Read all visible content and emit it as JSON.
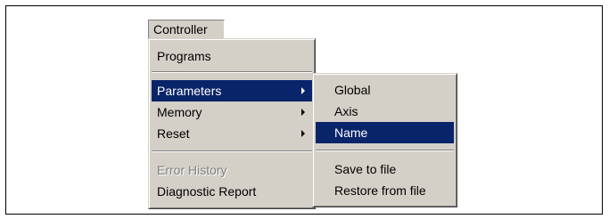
{
  "menubar": {
    "label": "Controller"
  },
  "main_menu": {
    "items": [
      {
        "label": "Programs"
      },
      {
        "label": "Parameters"
      },
      {
        "label": "Memory"
      },
      {
        "label": "Reset"
      },
      {
        "label": "Error History"
      },
      {
        "label": "Diagnostic Report"
      }
    ]
  },
  "submenu": {
    "items": [
      {
        "label": "Global"
      },
      {
        "label": "Axis"
      },
      {
        "label": "Name"
      },
      {
        "label": "Save to file"
      },
      {
        "label": "Restore from file"
      }
    ]
  },
  "colors": {
    "menu_face": "#d4d0c8",
    "highlight": "#0a246a",
    "disabled_text": "#808080"
  },
  "icons": [
    "submenu-arrow-icon"
  ]
}
